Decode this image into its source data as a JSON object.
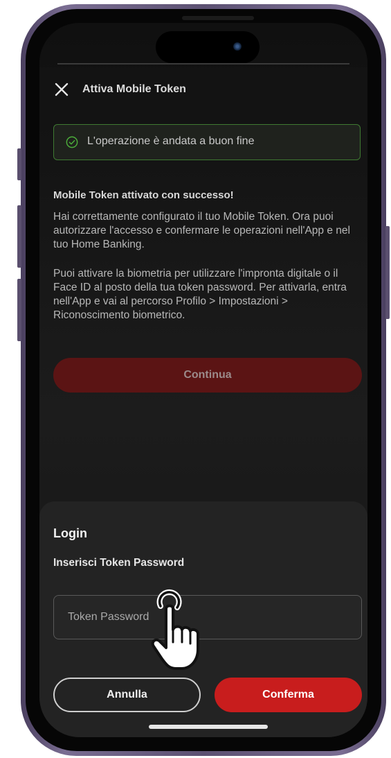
{
  "header": {
    "title": "Attiva Mobile Token"
  },
  "banner": {
    "text": "L'operazione è andata a buon fine",
    "color": "#3f7a32"
  },
  "content": {
    "heading": "Mobile Token attivato con successo!",
    "paragraph1": "Hai correttamente configurato il tuo Mobile Token. Ora puoi autorizzare l'accesso e confermare le operazioni nell'App e nel tuo Home Banking.",
    "paragraph2": "Puoi attivare la biometria per utilizzare l'impronta digitale o il Face ID al posto della tua token password. Per attivarla, entra nell'App e vai al percorso Profilo > Impostazioni > Riconoscimento biometrico.",
    "continue_label": "Continua"
  },
  "login_sheet": {
    "title": "Login",
    "subtitle": "Inserisci Token Password",
    "input_placeholder": "Token Password",
    "cancel_label": "Annulla",
    "confirm_label": "Conferma",
    "accent_color": "#c81d1d"
  },
  "icons": [
    "close-icon",
    "check-circle-icon",
    "tap-hand-icon"
  ]
}
